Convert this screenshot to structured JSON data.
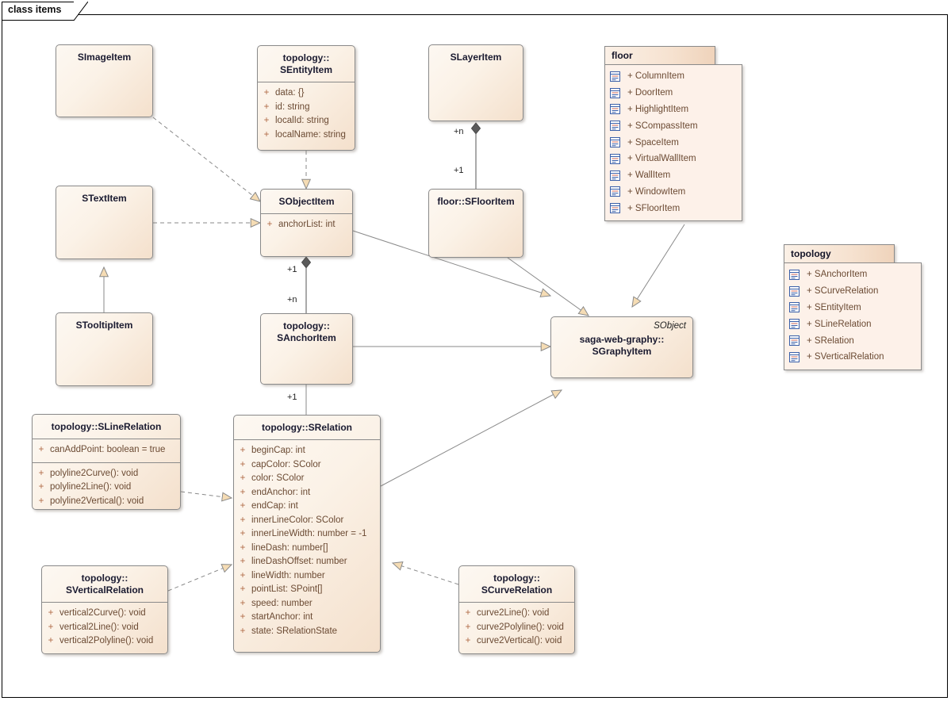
{
  "diagram": {
    "label": "class items",
    "colors": {
      "fill_light": "#fdf8f2",
      "fill_dark": "#f4e0cc",
      "border": "#8a8a8a",
      "member_text": "#6b4a33",
      "title_text": "#1a1a30",
      "arrow_fill": "#f5dcb4",
      "package_header": "#f6e2d0",
      "icon_blue": "#3a5fa8"
    }
  },
  "classes": {
    "simageitem": {
      "title": [
        "SImageItem"
      ]
    },
    "sentityitem": {
      "title": [
        "topology::",
        "SEntityItem"
      ],
      "attributes": [
        {
          "vis": "+",
          "sig": "data: {}"
        },
        {
          "vis": "+",
          "sig": "id: string"
        },
        {
          "vis": "+",
          "sig": "localId: string"
        },
        {
          "vis": "+",
          "sig": "localName: string"
        }
      ]
    },
    "slayeritem": {
      "title": [
        "SLayerItem"
      ]
    },
    "stextitem": {
      "title": [
        "STextItem"
      ]
    },
    "stooltipitem": {
      "title": [
        "STooltipItem"
      ]
    },
    "sobjectitem": {
      "title": [
        "SObjectItem"
      ],
      "attributes": [
        {
          "vis": "+",
          "sig": "anchorList: int"
        }
      ]
    },
    "sflooritem": {
      "title": [
        "floor::SFloorItem"
      ]
    },
    "sanchoritem": {
      "title": [
        "topology::",
        "SAnchorItem"
      ]
    },
    "sgraphyitem": {
      "title": [
        "saga-web-graphy::",
        "SGraphyItem"
      ],
      "stereotype": "SObject"
    },
    "slinerelation": {
      "title": [
        "topology::SLineRelation"
      ],
      "attributes": [
        {
          "vis": "+",
          "sig": "canAddPoint: boolean = true"
        }
      ],
      "operations": [
        {
          "vis": "+",
          "sig": "polyline2Curve(): void"
        },
        {
          "vis": "+",
          "sig": "polyline2Line(): void"
        },
        {
          "vis": "+",
          "sig": "polyline2Vertical(): void"
        }
      ]
    },
    "sverticalrelation": {
      "title": [
        "topology::",
        "SVerticalRelation"
      ],
      "operations": [
        {
          "vis": "+",
          "sig": "vertical2Curve(): void"
        },
        {
          "vis": "+",
          "sig": "vertical2Line(): void"
        },
        {
          "vis": "+",
          "sig": "vertical2Polyline(): void"
        }
      ]
    },
    "scurverelation": {
      "title": [
        "topology::",
        "SCurveRelation"
      ],
      "operations": [
        {
          "vis": "+",
          "sig": "curve2Line(): void"
        },
        {
          "vis": "+",
          "sig": "curve2Polyline(): void"
        },
        {
          "vis": "+",
          "sig": "curve2Vertical(): void"
        }
      ]
    },
    "srelation": {
      "title": [
        "topology::SRelation"
      ],
      "attributes": [
        {
          "vis": "+",
          "sig": "beginCap: int"
        },
        {
          "vis": "+",
          "sig": "capColor: SColor"
        },
        {
          "vis": "+",
          "sig": "color: SColor"
        },
        {
          "vis": "+",
          "sig": "endAnchor: int"
        },
        {
          "vis": "+",
          "sig": "endCap: int"
        },
        {
          "vis": "+",
          "sig": "innerLineColor: SColor"
        },
        {
          "vis": "+",
          "sig": "innerLineWidth: number = -1"
        },
        {
          "vis": "+",
          "sig": "lineDash: number[]"
        },
        {
          "vis": "+",
          "sig": "lineDashOffset: number"
        },
        {
          "vis": "+",
          "sig": "lineWidth: number"
        },
        {
          "vis": "+",
          "sig": "pointList: SPoint[]"
        },
        {
          "vis": "+",
          "sig": "speed: number"
        },
        {
          "vis": "+",
          "sig": "startAnchor: int"
        },
        {
          "vis": "+",
          "sig": "state: SRelationState"
        }
      ]
    }
  },
  "packages": {
    "floor": {
      "name": "floor",
      "items": [
        {
          "vis": "+",
          "name": "ColumnItem"
        },
        {
          "vis": "+",
          "name": "DoorItem"
        },
        {
          "vis": "+",
          "name": "HighlightItem"
        },
        {
          "vis": "+",
          "name": "SCompassItem"
        },
        {
          "vis": "+",
          "name": "SpaceItem"
        },
        {
          "vis": "+",
          "name": "VirtualWallItem"
        },
        {
          "vis": "+",
          "name": "WallItem"
        },
        {
          "vis": "+",
          "name": "WindowItem"
        },
        {
          "vis": "+",
          "name": "SFloorItem"
        }
      ]
    },
    "topology": {
      "name": "topology",
      "items": [
        {
          "vis": "+",
          "name": "SAnchorItem"
        },
        {
          "vis": "+",
          "name": "SCurveRelation"
        },
        {
          "vis": "+",
          "name": "SEntityItem"
        },
        {
          "vis": "+",
          "name": "SLineRelation"
        },
        {
          "vis": "+",
          "name": "SRelation"
        },
        {
          "vis": "+",
          "name": "SVerticalRelation"
        }
      ]
    }
  },
  "multiplicities": {
    "layer_floor_n": "+n",
    "layer_floor_1": "+1",
    "object_anchor_1": "+1",
    "object_anchor_n": "+n",
    "anchor_relation_1": "+1"
  }
}
